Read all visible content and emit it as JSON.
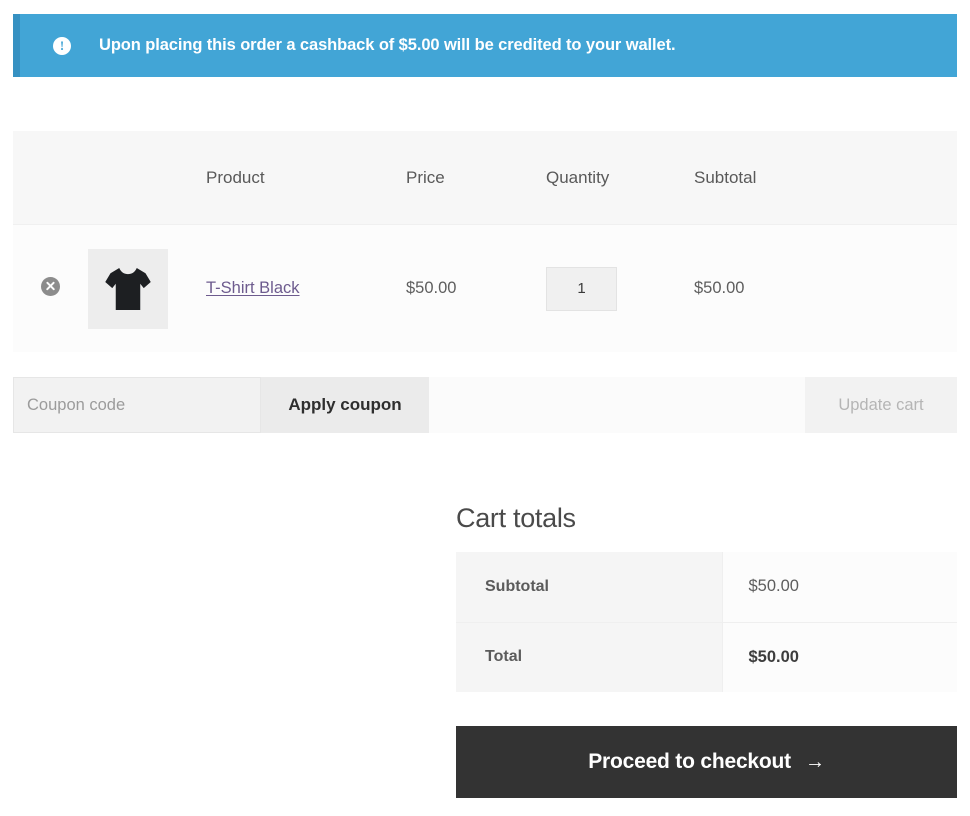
{
  "notice": {
    "icon": "exclamation-circle-icon",
    "message": "Upon placing this order a cashback of $5.00 will be credited to your wallet.",
    "bg_color": "#42a5d6",
    "border_color": "#3691c2"
  },
  "cart_table": {
    "headers": {
      "remove": "",
      "thumbnail": "",
      "product": "Product",
      "price": "Price",
      "quantity": "Quantity",
      "subtotal": "Subtotal"
    },
    "rows": [
      {
        "remove_icon": "remove-item-icon",
        "thumbnail_icon": "tshirt-thumbnail",
        "product_name": "T-Shirt Black",
        "price": "$50.00",
        "quantity": "1",
        "subtotal": "$50.00"
      }
    ]
  },
  "coupon": {
    "placeholder": "Coupon code",
    "value": "",
    "apply_label": "Apply coupon",
    "update_label": "Update cart"
  },
  "totals": {
    "title": "Cart totals",
    "rows": [
      {
        "label": "Subtotal",
        "value": "$50.00"
      },
      {
        "label": "Total",
        "value": "$50.00"
      }
    ],
    "checkout_label": "Proceed to checkout",
    "checkout_arrow": "→"
  }
}
